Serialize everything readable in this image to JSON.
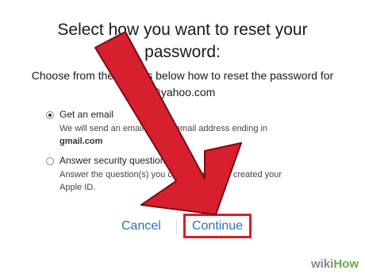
{
  "dialog": {
    "title_line1": "Select how you want to reset your",
    "title_line2": "password:",
    "subtitle_line1": "Choose from the options below how to reset the password for",
    "subtitle_line2": "@yahoo.com"
  },
  "options": [
    {
      "label": "Get an email",
      "desc_line1": "We will send an email to your email address ending in",
      "desc_line2": "gmail.com",
      "selected": true
    },
    {
      "label": "Answer security questions",
      "desc_line1": "Answer the question(s) you chose when you created your",
      "desc_line2": "Apple ID.",
      "selected": false
    }
  ],
  "buttons": {
    "cancel": "Cancel",
    "continue": "Continue"
  },
  "watermark": {
    "wiki": "wiki",
    "how": "How"
  },
  "colors": {
    "link": "#2a74b8",
    "highlight_border": "#e01b22",
    "arrow_fill": "#d81f2e"
  },
  "overlay": {
    "arrow_icon": "red-arrow-pointer"
  }
}
